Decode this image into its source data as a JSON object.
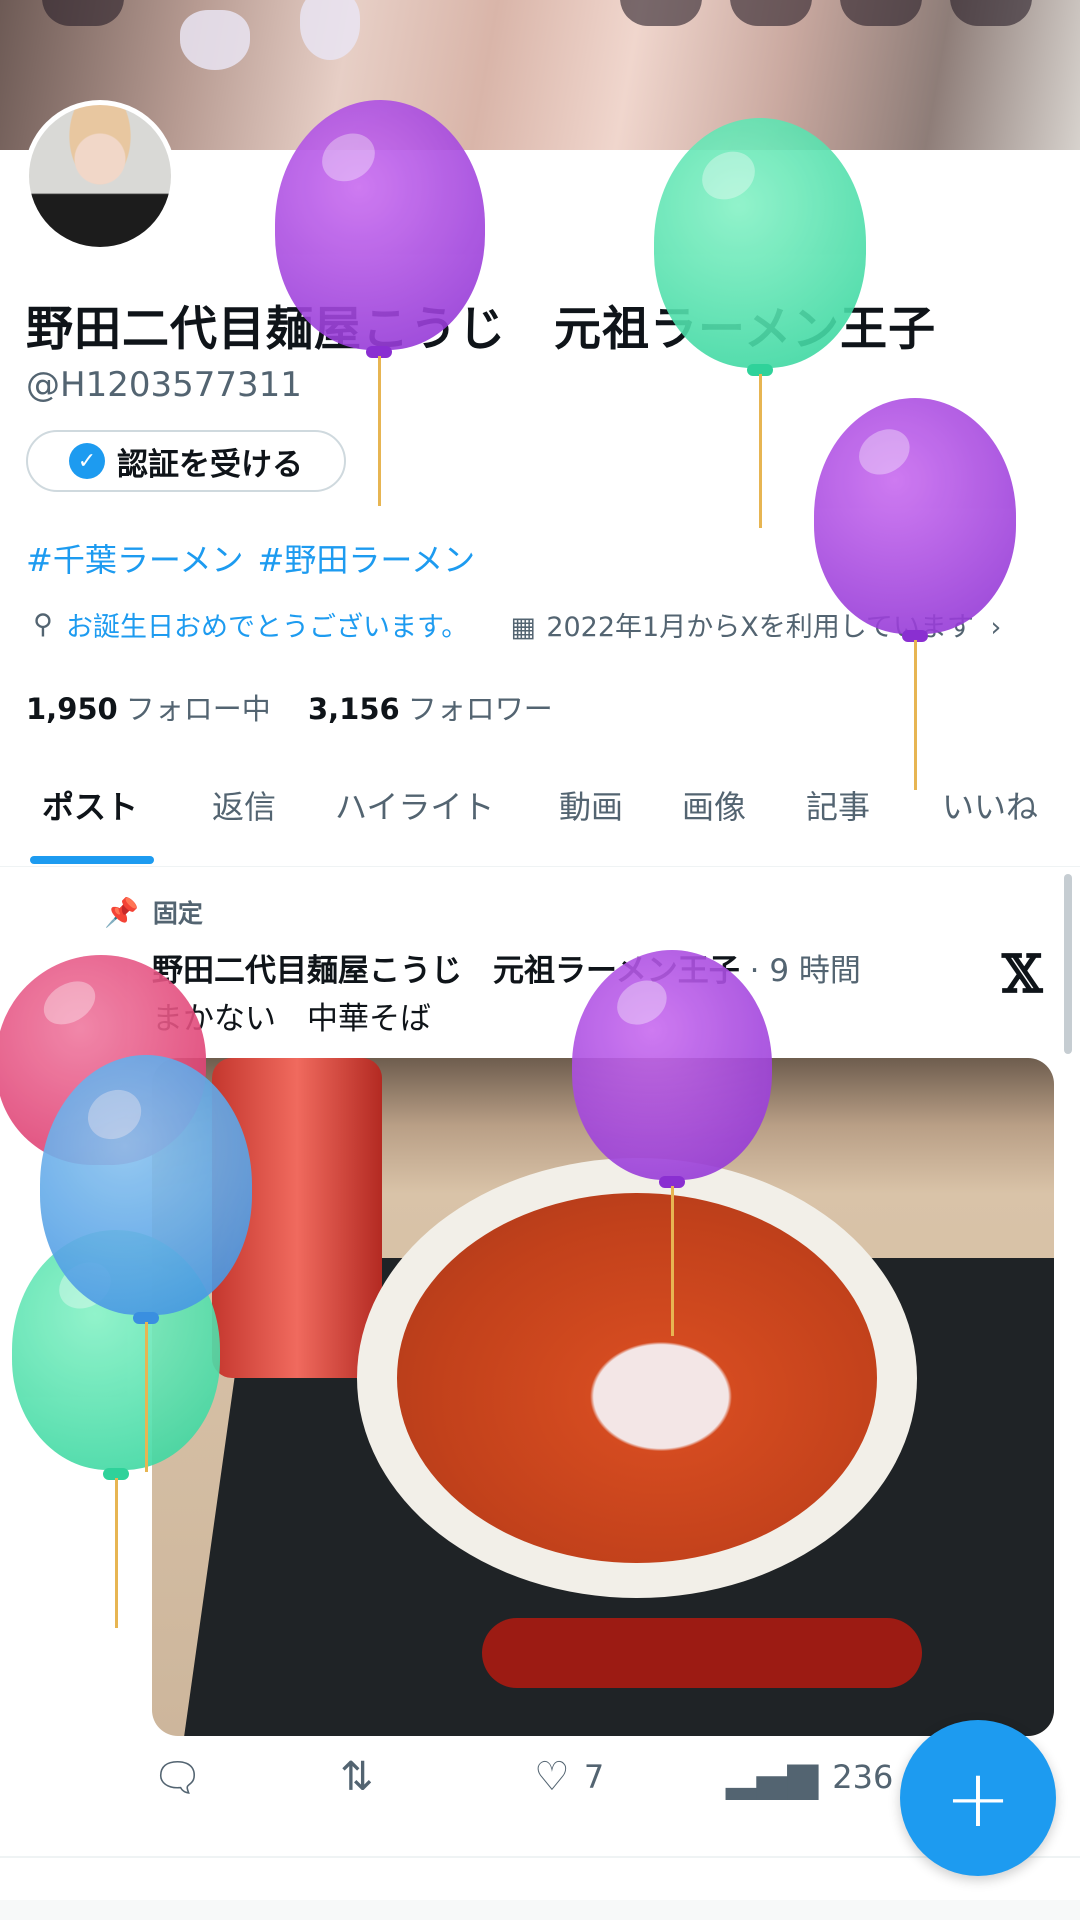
{
  "profile": {
    "display_name": "野田二代目麺屋こうじ　元祖ラーメン王子",
    "handle": "@H1203577311",
    "verify_button": "認証を受ける",
    "hashtags": [
      "#千葉ラーメン",
      "#野田ラーメン"
    ],
    "birthday_text": "お誕生日おめでとうございます。",
    "joined_text": "2022年1月からXを利用しています",
    "following_count": "1,950",
    "following_label": "フォロー中",
    "followers_count": "3,156",
    "followers_label": "フォロワー"
  },
  "tabs": [
    {
      "label": "ポスト",
      "active": true
    },
    {
      "label": "返信",
      "active": false
    },
    {
      "label": "ハイライト",
      "active": false
    },
    {
      "label": "動画",
      "active": false
    },
    {
      "label": "画像",
      "active": false
    },
    {
      "label": "記事",
      "active": false
    },
    {
      "label": "いいね",
      "active": false
    }
  ],
  "post": {
    "pinned_label": "固定",
    "author": "野田二代目麺屋こうじ　元祖ラーメン王子",
    "time": "· 9 時間",
    "text": "まかない　中華そば",
    "likes": "7",
    "views": "236"
  },
  "icons": {
    "pin": "pin-icon",
    "reply": "reply-icon",
    "retweet": "retweet-icon",
    "like": "heart-icon",
    "views": "views-icon",
    "compose": "plus-icon",
    "location": "location-icon",
    "calendar": "calendar-icon",
    "x_logo": "x-logo-icon"
  },
  "colors": {
    "accent": "#1d9bf0",
    "text": "#0f1419",
    "secondary": "#536471"
  }
}
